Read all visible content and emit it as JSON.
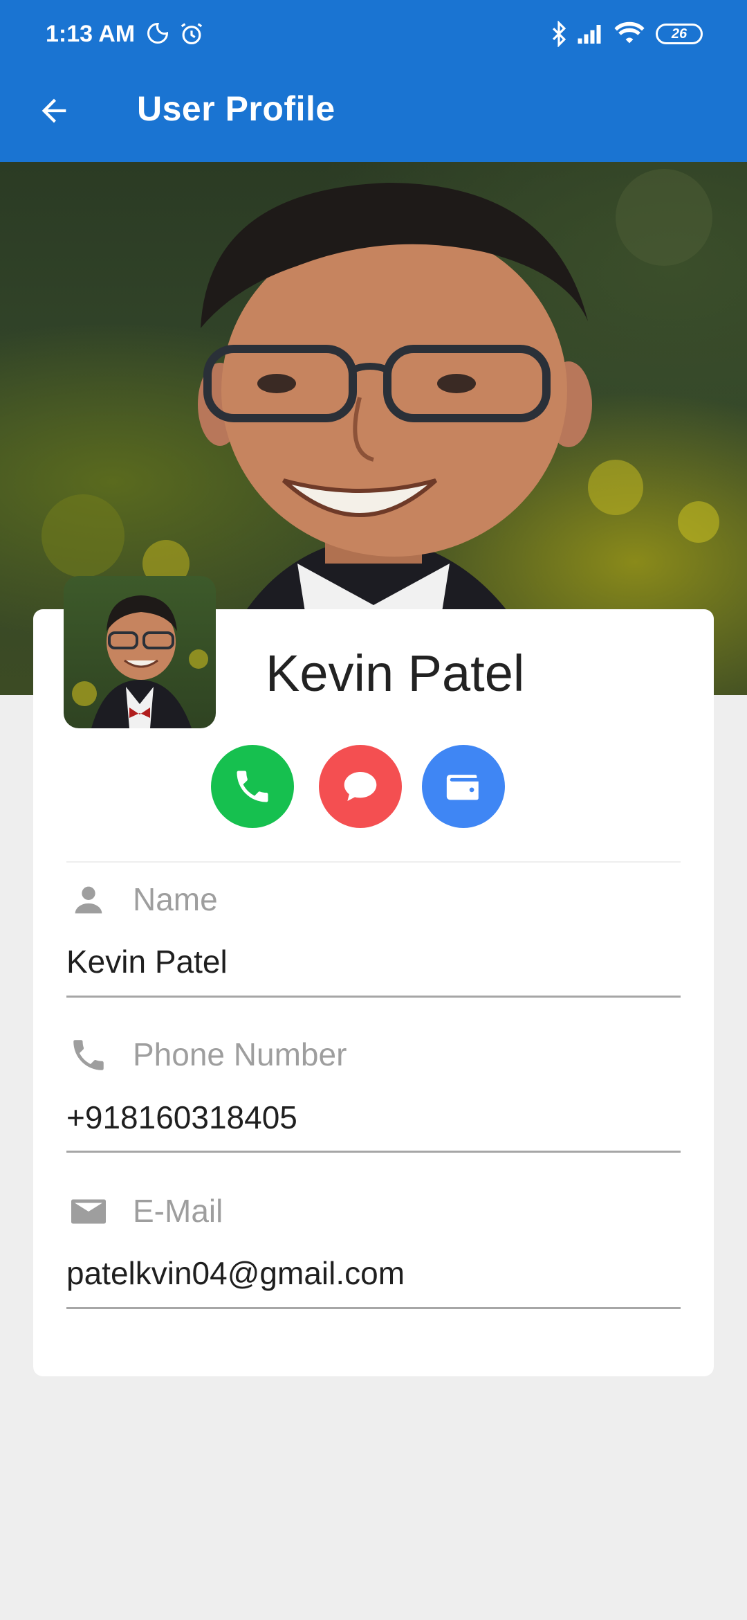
{
  "status_bar": {
    "time": "1:13 AM",
    "battery": "26",
    "icons": [
      "moon-icon",
      "alarm-icon",
      "bluetooth-icon",
      "signal-icon",
      "wifi-icon",
      "battery-icon"
    ]
  },
  "app_bar": {
    "title": "User Profile",
    "back_icon": "arrow-back-icon",
    "color": "#1a74d2"
  },
  "profile": {
    "name": "Kevin Patel"
  },
  "actions": [
    {
      "name": "call",
      "icon": "phone-icon",
      "color": "#16c04f"
    },
    {
      "name": "message",
      "icon": "chat-bubble-icon",
      "color": "#f44f51"
    },
    {
      "name": "wallet",
      "icon": "wallet-icon",
      "color": "#3f86f4"
    }
  ],
  "fields": {
    "name": {
      "label": "Name",
      "value": "Kevin Patel",
      "icon": "person-icon"
    },
    "phone": {
      "label": "Phone Number",
      "value": "+918160318405",
      "icon": "phone-icon"
    },
    "email": {
      "label": "E-Mail",
      "value": "patelkvin04@gmail.com",
      "icon": "mail-icon"
    }
  }
}
